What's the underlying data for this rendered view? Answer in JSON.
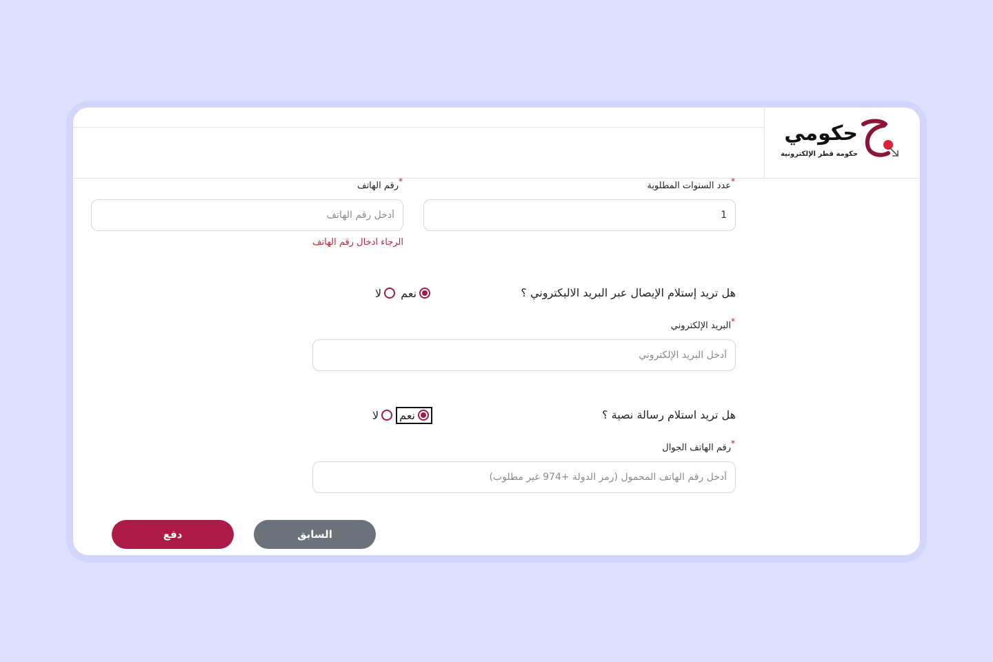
{
  "logo": {
    "name": "حكومي",
    "subtitle": "حكومة قطر الإلكترونية"
  },
  "form": {
    "years": {
      "label": "عدد السنوات المطلوبة",
      "value": "1",
      "required_mark": "*"
    },
    "phone": {
      "label": "رقم الهاتف",
      "placeholder": "أدخل رقم الهاتف",
      "required_mark": "*",
      "error": "الرجاء ادخال رقم الهاتف"
    },
    "email_question": {
      "text": "هل تريد إستلام الإيصال عبر البريد الاليكتروني ؟",
      "yes": "نعم",
      "no": "لا"
    },
    "email": {
      "label": "البريد الإلكتروني",
      "placeholder": "أدخل البريد الإلكتروني",
      "required_mark": "*"
    },
    "sms_question": {
      "text": "هل تريد استلام رسالة نصية ؟",
      "yes": "نعم",
      "no": "لا"
    },
    "mobile": {
      "label": "رقم الهاتف الجوال",
      "placeholder": "أدخل رقم الهاتف المحمول (رمز الدولة +974 غير مطلوب)",
      "required_mark": "*"
    }
  },
  "buttons": {
    "previous": "السابق",
    "pay": "دفع"
  },
  "colors": {
    "primary": "#ad1a47",
    "secondary": "#6b727a",
    "error": "#b3263e",
    "background": "#dfe0fd"
  }
}
